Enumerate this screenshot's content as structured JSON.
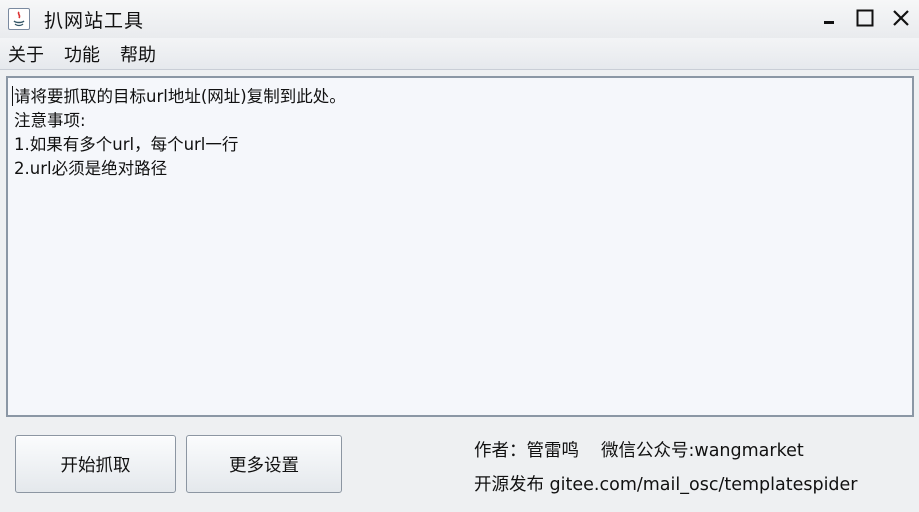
{
  "window": {
    "title": "扒网站工具",
    "icon": "java-app-icon",
    "controls": [
      "minimize-icon",
      "maximize-icon",
      "close-icon"
    ]
  },
  "menu": {
    "items": [
      "关于",
      "功能",
      "帮助"
    ]
  },
  "main": {
    "textarea_value": "请将要抓取的目标url地址(网址)复制到此处。\n注意事项:\n1.如果有多个url，每个url一行\n2.url必须是绝对路径"
  },
  "buttons": {
    "start": "开始抓取",
    "more_settings": "更多设置"
  },
  "footer": {
    "author": "作者：管雷鸣",
    "wechat": "微信公众号:wangmarket",
    "open_source": "开源发布 gitee.com/mail_osc/templatespider"
  },
  "colors": {
    "background": "#eef0f2",
    "textarea_bg": "#f5f7fb",
    "border": "#8b97a5"
  }
}
